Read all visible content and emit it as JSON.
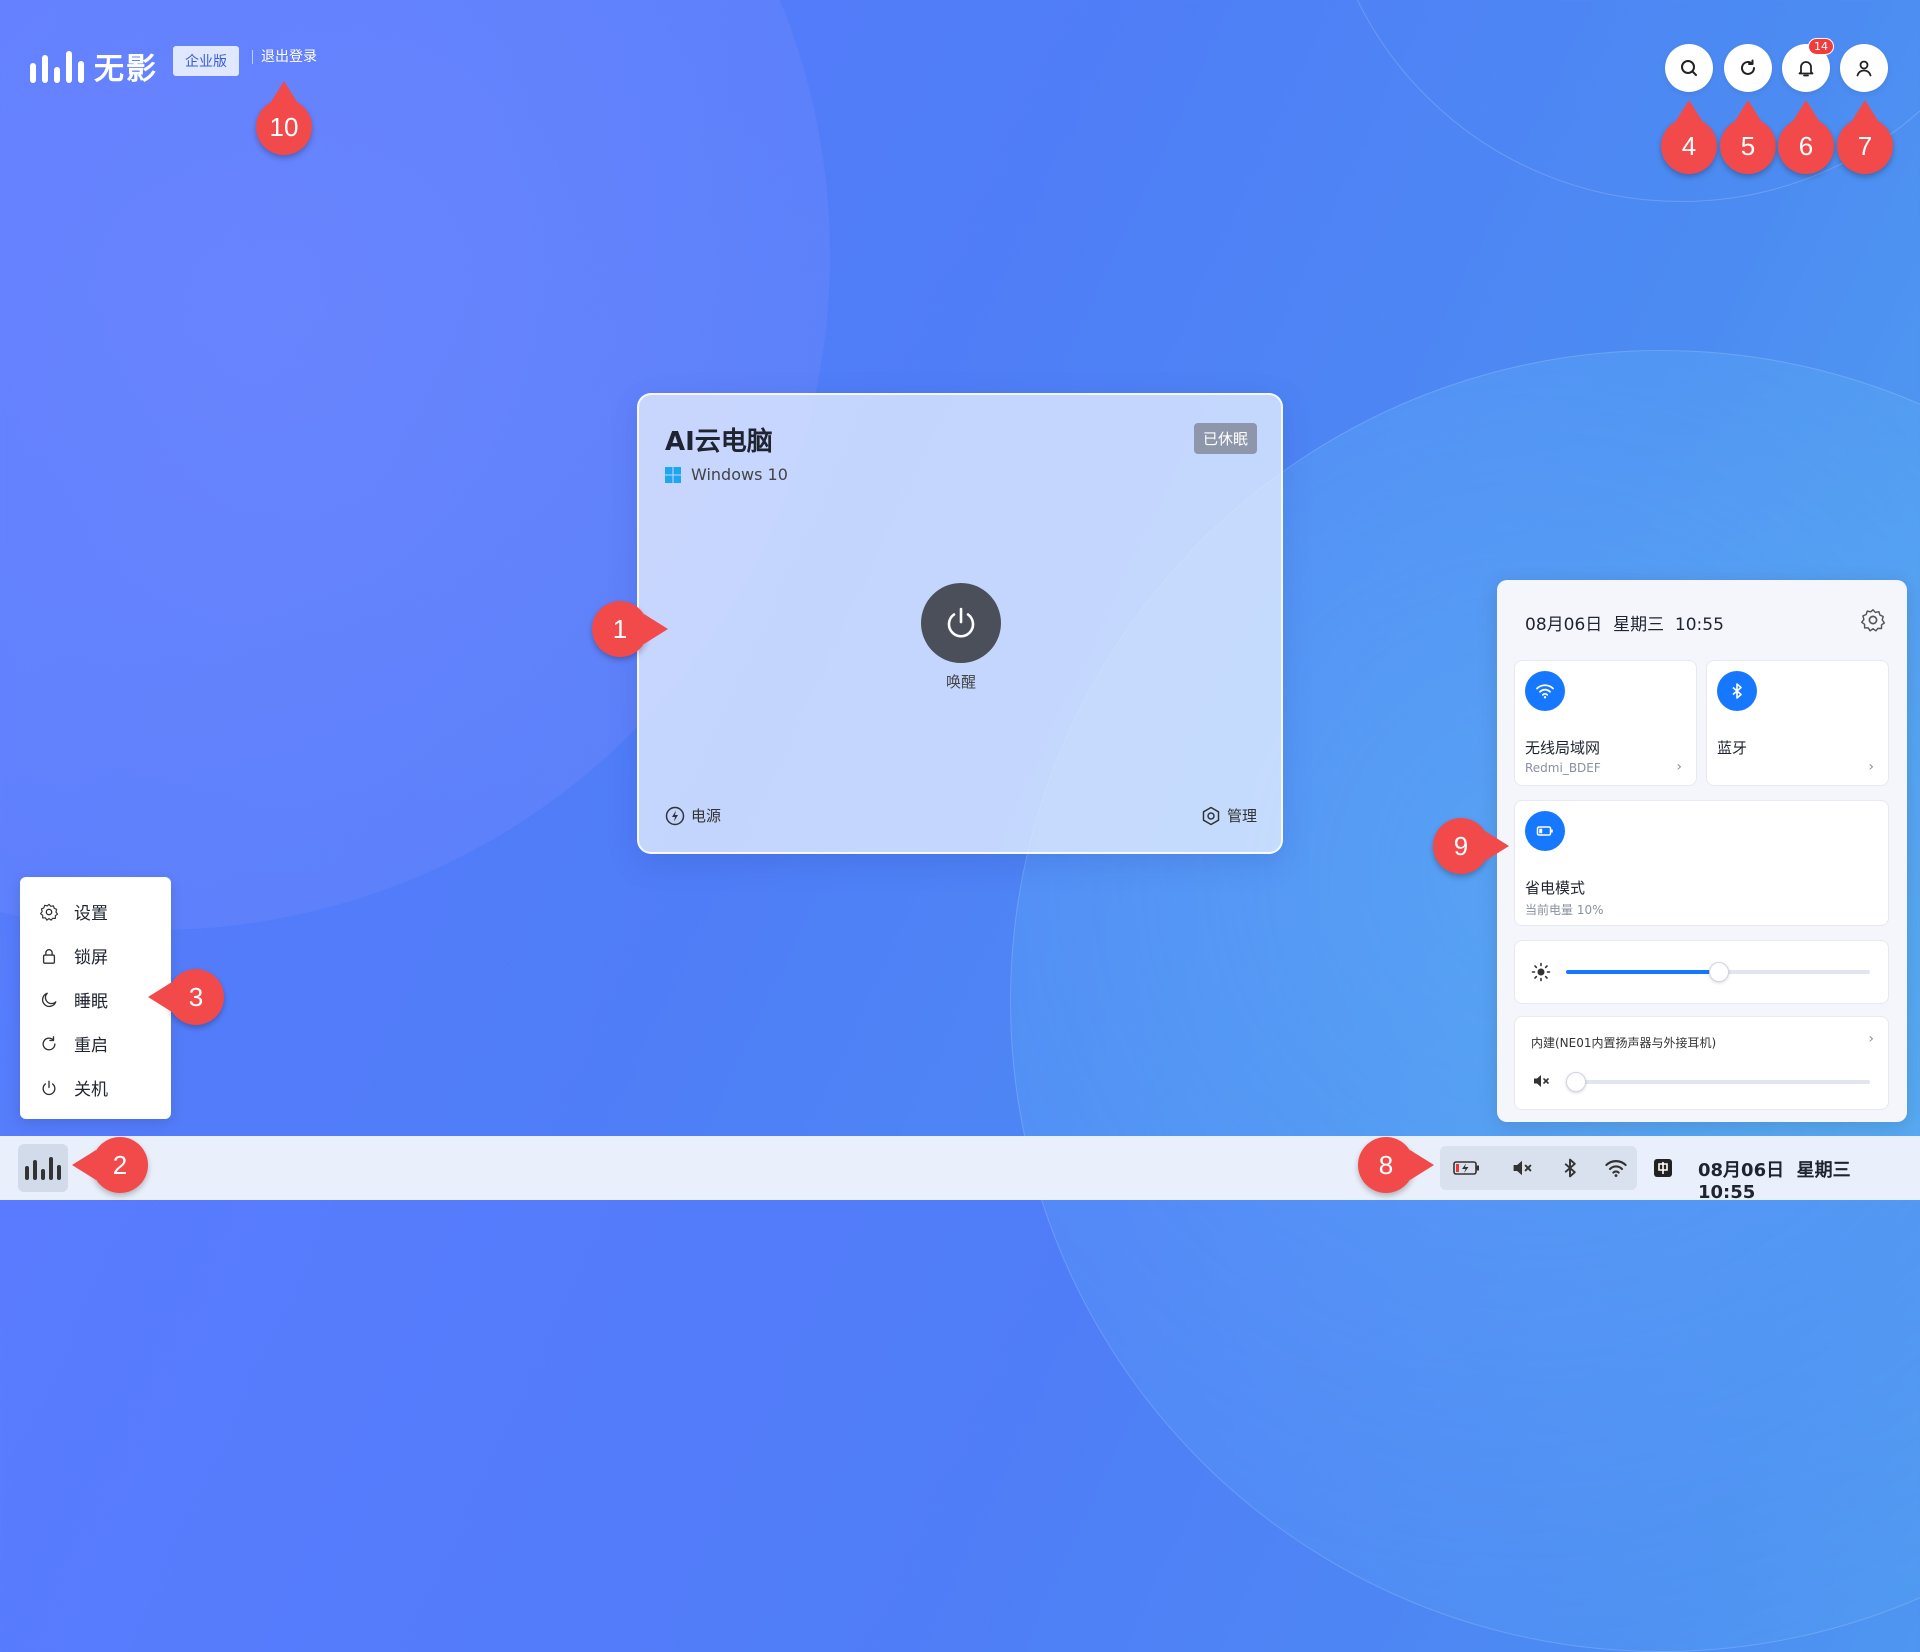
{
  "header": {
    "logo_text": "无影",
    "edition_label": "企业版",
    "logout_label": "退出登录",
    "notification_count": "14",
    "buttons": [
      "search-icon",
      "refresh-icon",
      "bell-icon",
      "user-icon"
    ]
  },
  "card": {
    "title": "AI云电脑",
    "os": "Windows 10",
    "status": "已休眠",
    "power_action": "唤醒",
    "footer_left": "电源",
    "footer_right": "管理"
  },
  "start_menu": {
    "items": [
      {
        "label": "设置",
        "icon": "gear-icon"
      },
      {
        "label": "锁屏",
        "icon": "lock-icon"
      },
      {
        "label": "睡眠",
        "icon": "moon-icon"
      },
      {
        "label": "重启",
        "icon": "restart-icon"
      },
      {
        "label": "关机",
        "icon": "power-icon"
      }
    ]
  },
  "panel": {
    "date": "08月06日",
    "weekday": "星期三",
    "time": "10:55",
    "wifi": {
      "label": "无线局域网",
      "network": "Redmi_BDEF"
    },
    "bluetooth": {
      "label": "蓝牙"
    },
    "power_saving": {
      "label": "省电模式",
      "battery": "当前电量 10%"
    },
    "brightness_level": 0.5,
    "audio_device": "内建(NE01内置扬声器与外接耳机)",
    "volume_level": 0
  },
  "taskbar": {
    "date": "08月06日",
    "weekday": "星期三",
    "time": "10:55",
    "tray_icons": [
      "battery-charging-icon",
      "mute-icon",
      "bluetooth-icon",
      "wifi-icon"
    ]
  },
  "markers": [
    "1",
    "2",
    "3",
    "4",
    "5",
    "6",
    "7",
    "8",
    "9",
    "10"
  ],
  "colors": {
    "accent": "#1677ff",
    "marker": "#f24a4a",
    "status_badge": "#8d96aa"
  }
}
